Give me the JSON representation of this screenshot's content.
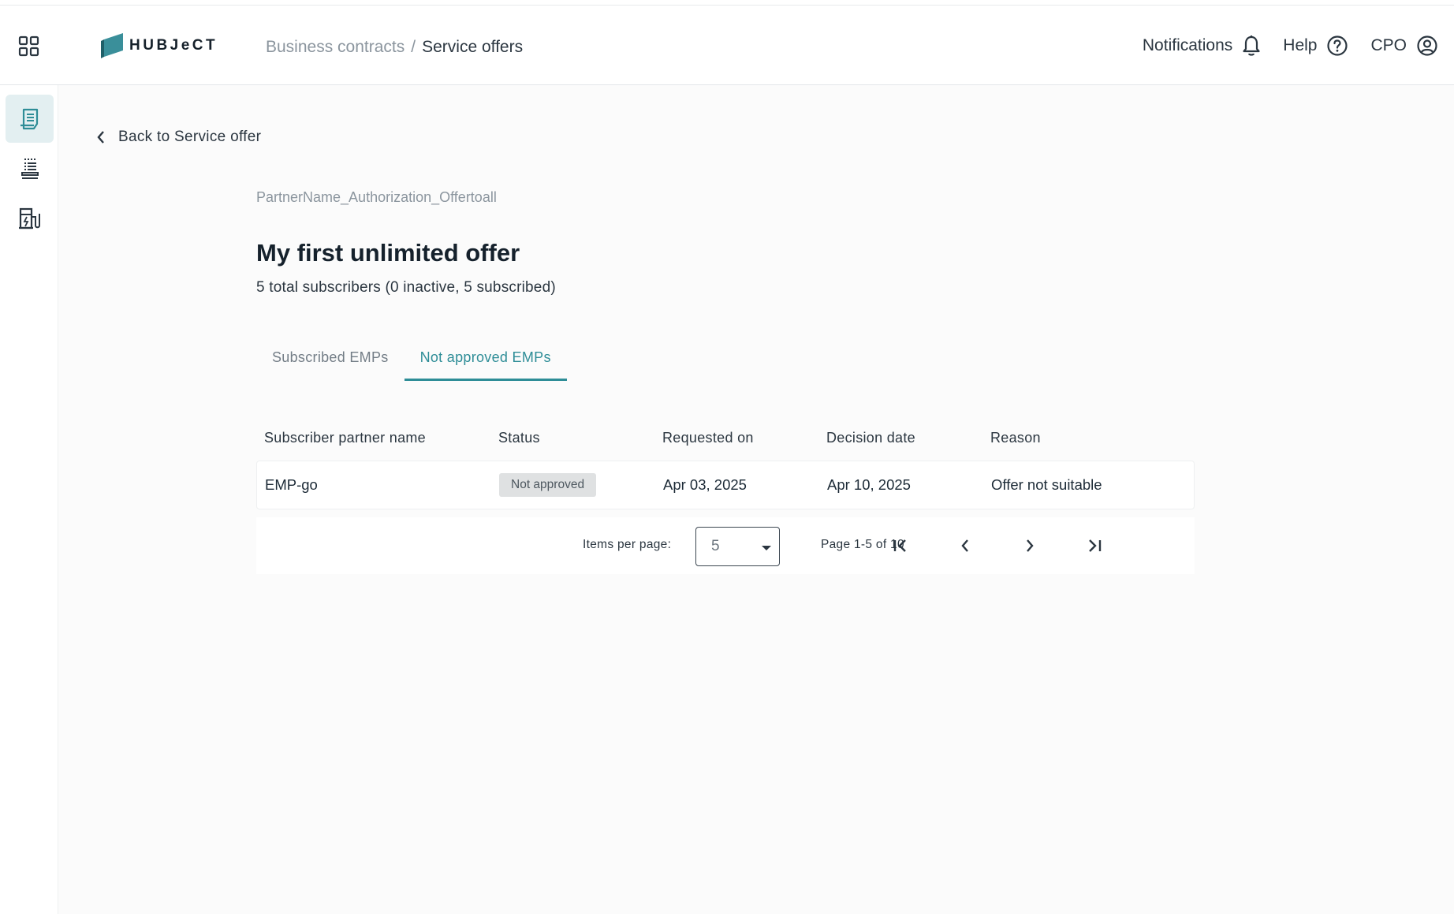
{
  "header": {
    "logo_text": "HUBJeCT",
    "breadcrumb": {
      "parent": "Business contracts",
      "separator": "/",
      "current": "Service offers"
    },
    "actions": {
      "notifications": "Notifications",
      "help": "Help",
      "user": "CPO"
    }
  },
  "sidebar": {
    "items": [
      {
        "name": "contracts",
        "active": true
      },
      {
        "name": "list",
        "active": false
      },
      {
        "name": "charging-station",
        "active": false
      }
    ]
  },
  "page": {
    "back_label": "Back to Service offer",
    "partner_name": "PartnerName_Authorization_Offertoall",
    "title": "My first unlimited offer",
    "subscribers_summary": "5 total subscribers (0 inactive, 5 subscribed)",
    "tabs": [
      {
        "label": "Subscribed EMPs",
        "active": false
      },
      {
        "label": "Not approved EMPs",
        "active": true
      }
    ]
  },
  "table": {
    "columns": [
      "Subscriber partner name",
      "Status",
      "Requested on",
      "Decision date",
      "Reason"
    ],
    "rows": [
      {
        "partner": "EMP-go",
        "status": "Not approved",
        "requested_on": "Apr 03, 2025",
        "decision_date": "Apr 10, 2025",
        "reason": "Offer not suitable"
      }
    ]
  },
  "pagination": {
    "items_per_page_label": "Items per page:",
    "items_per_page_value": "5",
    "page_info": "Page 1-5 of 10"
  },
  "colors": {
    "accent": "#2e8d97",
    "logo": "#3a8f9a"
  }
}
